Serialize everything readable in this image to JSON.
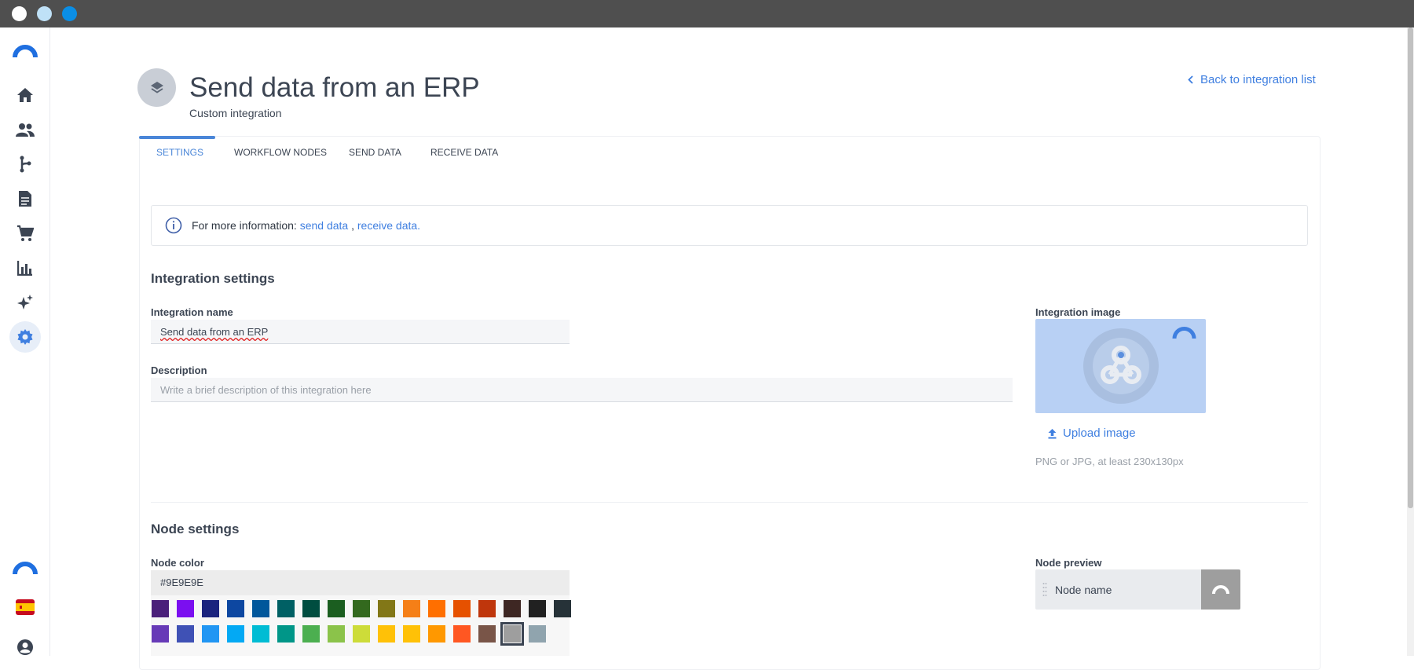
{
  "window": {
    "dot_colors": [
      "#ffffff",
      "#bfe1f7",
      "#0a8ee6"
    ]
  },
  "sidebar": {
    "items": [
      {
        "icon": "logo-icon"
      },
      {
        "icon": "home-icon"
      },
      {
        "icon": "people-icon"
      },
      {
        "icon": "workflow-icon"
      },
      {
        "icon": "document-icon"
      },
      {
        "icon": "cart-icon"
      },
      {
        "icon": "chart-icon"
      },
      {
        "icon": "sparkle-icon"
      },
      {
        "icon": "gear-icon",
        "active": true
      }
    ],
    "bottom_items": [
      {
        "icon": "logo-icon"
      },
      {
        "icon": "spain-flag-icon"
      },
      {
        "icon": "account-icon"
      }
    ]
  },
  "header": {
    "title": "Send data from an ERP",
    "subtitle": "Custom integration",
    "back_link": "Back to integration list"
  },
  "tabs": [
    {
      "label": "SETTINGS",
      "active": true
    },
    {
      "label": "WORKFLOW NODES"
    },
    {
      "label": "SEND DATA"
    },
    {
      "label": "RECEIVE DATA"
    }
  ],
  "info": {
    "prefix": "For more information:",
    "link1": "send data",
    "separator": ",",
    "link2": "receive data."
  },
  "integration_settings": {
    "title": "Integration settings",
    "name_label": "Integration name",
    "name_value": "Send data from an ERP",
    "description_label": "Description",
    "description_placeholder": "Write a brief description of this integration here",
    "image_label": "Integration image",
    "upload_label": "Upload image",
    "upload_hint": "PNG or JPG, at least 230x130px"
  },
  "node_settings": {
    "title": "Node settings",
    "color_label": "Node color",
    "color_value": "#9E9E9E",
    "swatches_row1": [
      "#4a1f7a",
      "#7b0ff0",
      "#1a237e",
      "#0d47a1",
      "#01579b",
      "#006064",
      "#004d40",
      "#1b5e20",
      "#33691e",
      "#827717",
      "#f57f17",
      "#ff6f00",
      "#e65100",
      "#bf360c",
      "#3e2723",
      "#212121",
      "#263238"
    ],
    "swatches_row2": [
      "#673ab7",
      "#3f51b5",
      "#2196f3",
      "#03a9f4",
      "#00bcd4",
      "#009688",
      "#4caf50",
      "#8bc34a",
      "#cddc39",
      "#ffc107",
      "#ffc107",
      "#ff9800",
      "#ff5722",
      "#795548",
      "#9e9e9e",
      "#90a4ae"
    ],
    "selected_swatch": "#9e9e9e",
    "preview_label": "Node preview",
    "preview_node_name": "Node name"
  }
}
